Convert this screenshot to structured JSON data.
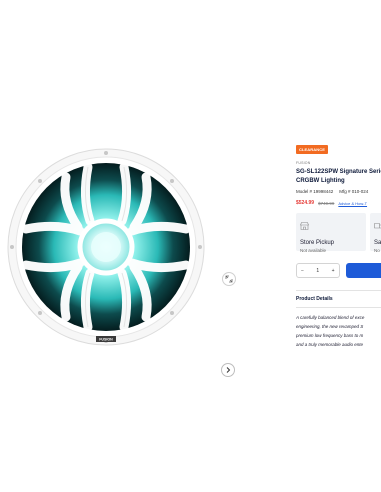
{
  "product": {
    "badge": "CLEARANCE",
    "brand": "FUSION",
    "title_line1": "SG-SL122SPW Signature Serie",
    "title_line2": "CRGBW Lighting",
    "model": "Model # 19998442",
    "mfg": "Mfg # 010-024",
    "price_sale": "$524.99",
    "price_old": "$749.99",
    "price_link": "Advice & How-T"
  },
  "fulfillment": [
    {
      "title": "Store Pickup",
      "status": "Not available"
    },
    {
      "title": "Sa",
      "status": "No"
    }
  ],
  "cart": {
    "quantity": "1",
    "minus": "−",
    "plus": "+"
  },
  "details": {
    "heading": "Product Details",
    "lines": [
      "A carefully balanced blend of exce",
      "engineering, the new revamped S",
      "premium low frequency bass to m",
      "and a truly memorable audio ente"
    ]
  },
  "gallery": {
    "speaker_label": "FUSION",
    "glow_color": "#5fd3d0"
  }
}
